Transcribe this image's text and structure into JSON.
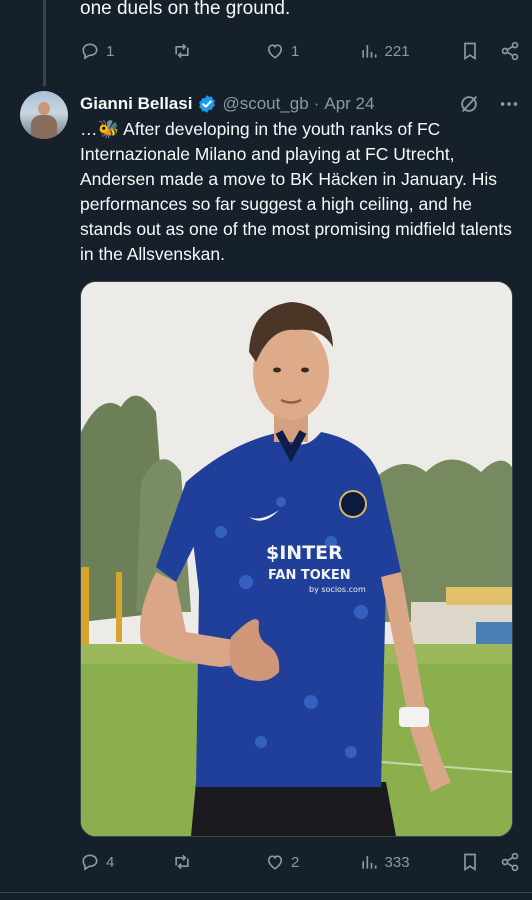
{
  "previous_tweet": {
    "text_tail": "one duels on the ground.",
    "stats": {
      "replies": "1",
      "retweets": "",
      "likes": "1",
      "views": "221"
    }
  },
  "tweet": {
    "author_name": "Gianni Bellasi",
    "handle": "@scout_gb",
    "separator": "·",
    "date": "Apr 24",
    "text": "…🐝 After developing in the youth ranks of FC Internazionale Milano and playing at FC Utrecht, Andersen made a move to BK Häcken in January. His performances so far suggest a high ceiling, and he stands out as one of the most promising midfield talents in the Allsvenskan.",
    "media": {
      "jersey_line1": "$INTER",
      "jersey_line2": "FAN TOKEN",
      "jersey_line3": "by socios.com"
    },
    "stats": {
      "replies": "4",
      "retweets": "",
      "likes": "2",
      "views": "333"
    }
  },
  "icons": {
    "reply": "reply-icon",
    "retweet": "retweet-icon",
    "like": "heart-icon",
    "views": "views-chart-icon",
    "bookmark": "bookmark-icon",
    "share": "share-icon",
    "grok": "grok-icon",
    "more": "more-dots-icon",
    "verified": "verified-badge-icon"
  },
  "colors": {
    "background": "#15202b",
    "text": "#f7f9f9",
    "muted": "#8b98a5",
    "verified": "#1d9bf0",
    "divider": "#38444d"
  }
}
